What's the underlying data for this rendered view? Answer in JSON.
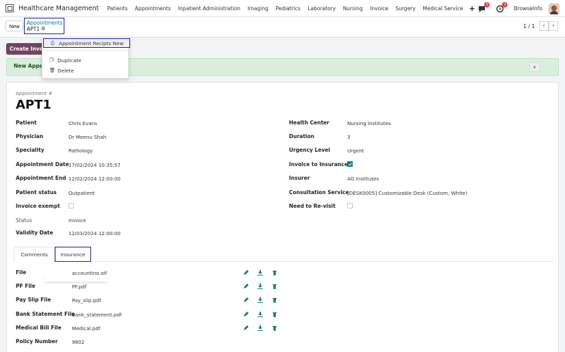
{
  "navbar": {
    "app_name": "Healthcare Management",
    "menu": [
      "Patients",
      "Appointments",
      "Inpatient Administration",
      "Imaging",
      "Pediatrics",
      "Laboratory",
      "Nursing",
      "Invoice",
      "Surgery",
      "Medical Service"
    ],
    "plus": "+",
    "messages_badge": "5",
    "activities_badge": "1",
    "user": "BrowseInfo"
  },
  "control": {
    "new_label": "New",
    "breadcrumb_parent": "Appointments",
    "breadcrumb_current": "APT1",
    "pager": "1 / 1"
  },
  "actions": {
    "create_invoice": "Create Invoice"
  },
  "alert": {
    "text": "New Appointment",
    "close": "x"
  },
  "dropdown": {
    "items": [
      "Appointment Recipts New",
      "Duplicate",
      "Delete"
    ]
  },
  "record": {
    "ref_label": "Appointment #",
    "ref_value": "APT1",
    "left_fields": [
      {
        "label": "Patient",
        "value": "Chris Evans"
      },
      {
        "label": "Physician",
        "value": "Dr Meenu Shah"
      },
      {
        "label": "Speciality",
        "value": "Pathology"
      },
      {
        "label": "Appointment Date",
        "value": "17/02/2024 10:35:57"
      },
      {
        "label": "Appointment End",
        "value": "12/02/2024 12:00:00"
      },
      {
        "label": "Patient status",
        "value": "Outpatient"
      },
      {
        "label": "Invoice exempt",
        "value": ""
      },
      {
        "label": "Status",
        "value": "Invoice"
      },
      {
        "label": "Validity Date",
        "value": "12/03/2024 12:00:00"
      }
    ],
    "right_fields": [
      {
        "label": "Health Center",
        "value": "Nursing Institutes"
      },
      {
        "label": "Duration",
        "value": "3"
      },
      {
        "label": "Urgency Level",
        "value": "Urgent"
      },
      {
        "label": "Invoice to Insurance",
        "value": ""
      },
      {
        "label": "Insurer",
        "value": "AG Institutes"
      },
      {
        "label": "Consultation Service",
        "value": "[DESK0005] Customizable Desk (Custom, White)"
      },
      {
        "label": "Need to Re-visit",
        "value": ""
      }
    ],
    "invoice_exempt_checked": false,
    "invoice_to_insurance_checked": true,
    "need_revisit_checked": false
  },
  "tabs": [
    "Comments",
    "Insurance"
  ],
  "insurance": {
    "files": [
      {
        "label": "File",
        "value": "accounting.gif"
      },
      {
        "label": "PF File",
        "value": "PF.pdf"
      },
      {
        "label": "Pay Slip File",
        "value": "Pay_slip.pdf"
      },
      {
        "label": "Bank Statement File",
        "value": "Bank_statement.pdf"
      },
      {
        "label": "Medical Bill File",
        "value": "Medical.pdf"
      }
    ],
    "policy_label": "Policy Number",
    "policy_value": "9802"
  },
  "colors": {
    "accent": "#017e84",
    "primary_button": "#71455e",
    "alert_bg": "#d9efdc",
    "highlight_border": "#1a1aa6",
    "badge": "#e23f3f"
  }
}
